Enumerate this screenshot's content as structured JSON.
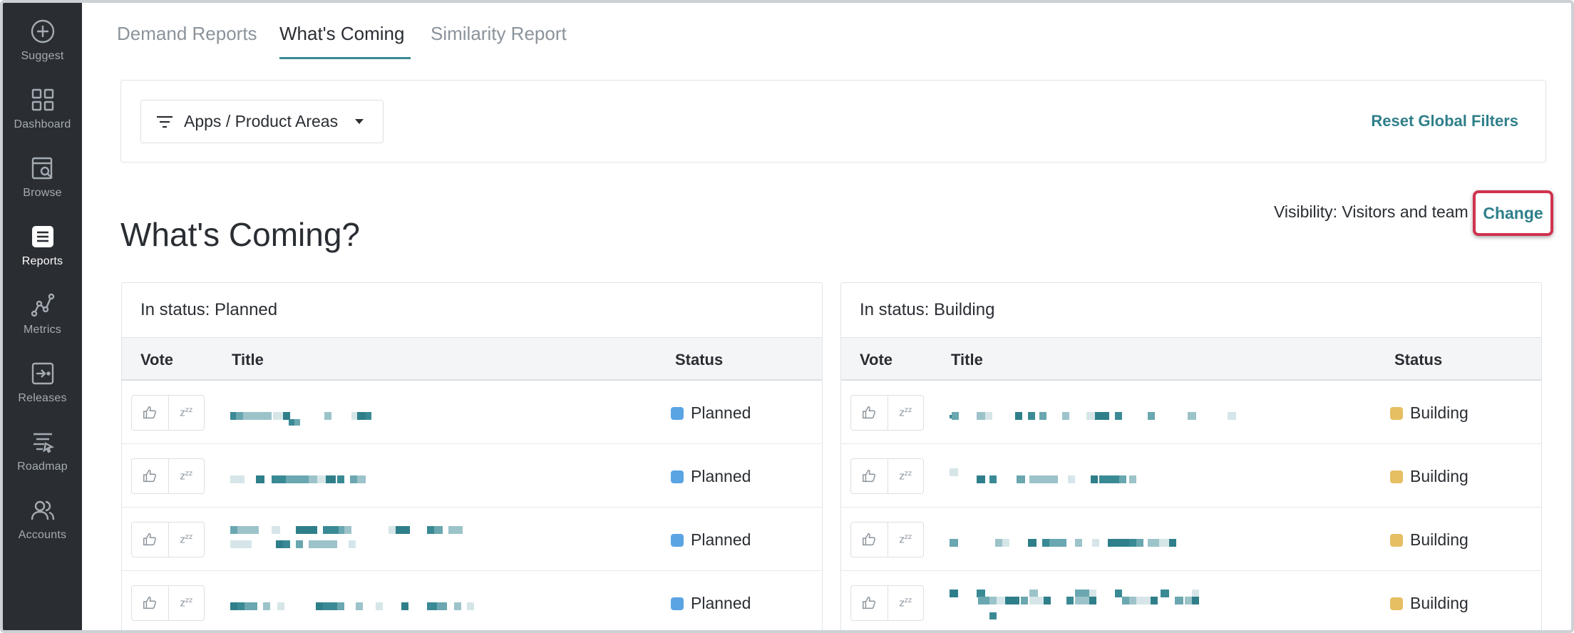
{
  "sidebar": {
    "items": [
      {
        "label": "Suggest",
        "icon": "plus-circle-icon"
      },
      {
        "label": "Dashboard",
        "icon": "grid-icon"
      },
      {
        "label": "Browse",
        "icon": "browse-search-icon"
      },
      {
        "label": "Reports",
        "icon": "reports-list-icon",
        "active": true
      },
      {
        "label": "Metrics",
        "icon": "metrics-graph-icon"
      },
      {
        "label": "Releases",
        "icon": "releases-icon"
      },
      {
        "label": "Roadmap",
        "icon": "roadmap-icon"
      },
      {
        "label": "Accounts",
        "icon": "accounts-users-icon"
      }
    ]
  },
  "tabs": [
    {
      "label": "Demand Reports"
    },
    {
      "label": "What's Coming",
      "active": true
    },
    {
      "label": "Similarity Report"
    }
  ],
  "filters": {
    "dropdown_label": "Apps / Product Areas",
    "reset_label": "Reset Global Filters"
  },
  "page": {
    "title": "What's Coming?",
    "visibility_text": "Visibility: Visitors and team",
    "change_label": "Change"
  },
  "columns": {
    "vote": "Vote",
    "title": "Title",
    "status": "Status"
  },
  "panels": {
    "planned": {
      "heading": "In status: Planned",
      "status_label": "Planned",
      "status_color": "#5aa4e4"
    },
    "building": {
      "heading": "In status: Building",
      "status_label": "Building",
      "status_color": "#e6bf63"
    }
  },
  "colors": {
    "sidebar_bg": "#2a2e33",
    "accent": "#3a8a95",
    "link": "#2f7f8a",
    "highlight_border": "#d0334f"
  }
}
